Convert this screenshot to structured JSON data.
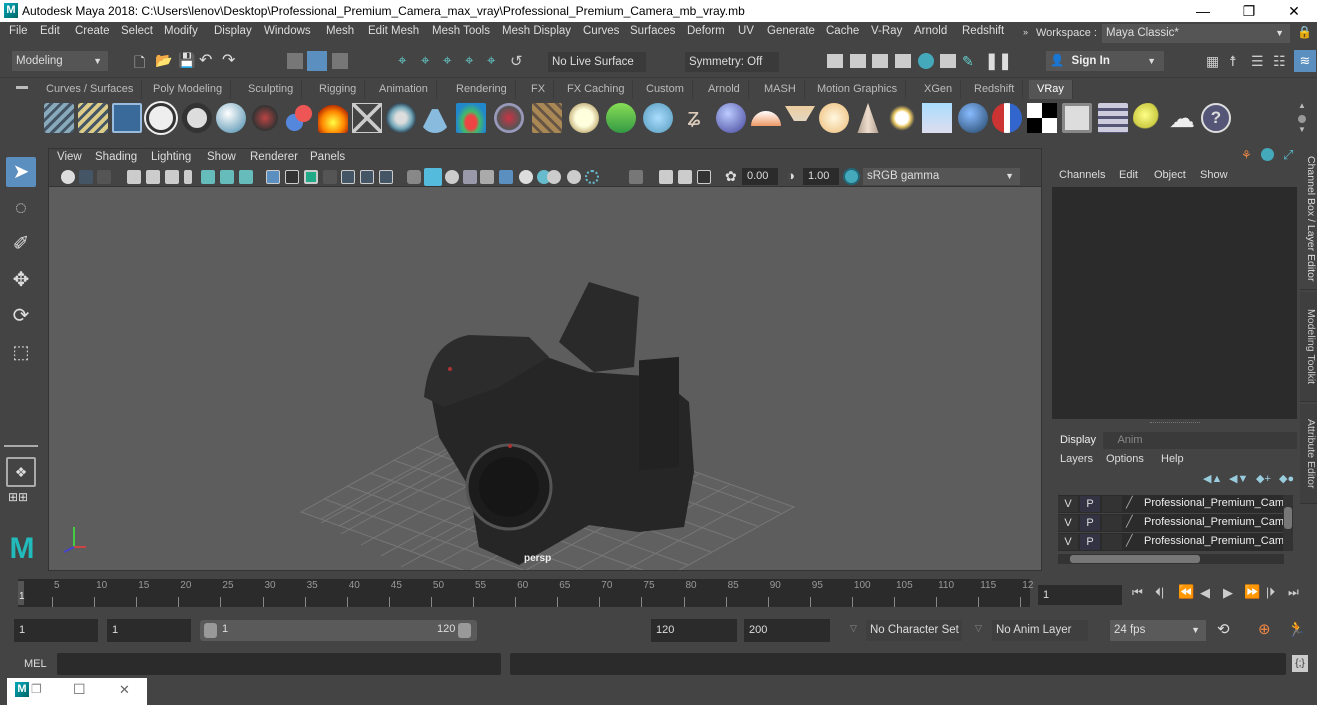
{
  "window": {
    "title": "Autodesk Maya 2018: C:\\Users\\lenov\\Desktop\\Professional_Premium_Camera_max_vray\\Professional_Premium_Camera_mb_vray.mb",
    "logo": "M",
    "minimize": "—",
    "restore": "❐",
    "close": "✕"
  },
  "menubar": {
    "items": [
      "File",
      "Edit",
      "Create",
      "Select",
      "Modify",
      "Display",
      "Windows",
      "Mesh",
      "Edit Mesh",
      "Mesh Tools",
      "Mesh Display",
      "Curves",
      "Surfaces",
      "Deform",
      "UV",
      "Generate",
      "Cache",
      "V-Ray",
      "Arnold",
      "Redshift"
    ],
    "workspace_label": "Workspace :",
    "workspace_value": "Maya Classic*"
  },
  "statusline": {
    "mode": "Modeling",
    "live_surface": "No Live Surface",
    "symmetry": "Symmetry: Off",
    "sign_in": "Sign In"
  },
  "shelf": {
    "tabs": [
      "Curves / Surfaces",
      "Poly Modeling",
      "Sculpting",
      "Rigging",
      "Animation",
      "Rendering",
      "FX",
      "FX Caching",
      "Custom",
      "Arnold",
      "MASH",
      "Motion Graphics",
      "XGen",
      "Redshift",
      "VRay"
    ],
    "active_tab": "VRay"
  },
  "viewport": {
    "menu": [
      "View",
      "Shading",
      "Lighting",
      "Show",
      "Renderer",
      "Panels"
    ],
    "exposure": "0.00",
    "gamma": "1.00",
    "color_space": "sRGB gamma",
    "camera_label": "persp"
  },
  "channelbox": {
    "menu": [
      "Channels",
      "Edit",
      "Object",
      "Show"
    ]
  },
  "side_tabs": [
    "Channel Box / Layer Editor",
    "Modeling Toolkit",
    "Attribute Editor"
  ],
  "layer_editor": {
    "tabs": [
      "Display",
      "Anim"
    ],
    "active_tab": "Display",
    "menu": [
      "Layers",
      "Options",
      "Help"
    ],
    "layers": [
      {
        "v": "V",
        "p": "P",
        "name": "Professional_Premium_Came"
      },
      {
        "v": "V",
        "p": "P",
        "name": "Professional_Premium_Came"
      },
      {
        "v": "V",
        "p": "P",
        "name": "Professional_Premium_Came"
      }
    ]
  },
  "timeline": {
    "ticks": [
      "5",
      "10",
      "15",
      "20",
      "25",
      "30",
      "35",
      "40",
      "45",
      "50",
      "55",
      "60",
      "65",
      "70",
      "75",
      "80",
      "85",
      "90",
      "95",
      "100",
      "105",
      "110",
      "115",
      "12"
    ],
    "current_frame_marker": "1",
    "current_frame": "1"
  },
  "range": {
    "start": "1",
    "playback_start": "1",
    "slider_min": "1",
    "slider_max": "120",
    "playback_end": "120",
    "end": "200",
    "character_set": "No Character Set",
    "anim_layer": "No Anim Layer",
    "fps": "24 fps"
  },
  "commandline": {
    "label": "MEL"
  },
  "taskbar": {
    "logo": "M",
    "restore": "❐",
    "maximize": "☐",
    "close": "✕"
  }
}
